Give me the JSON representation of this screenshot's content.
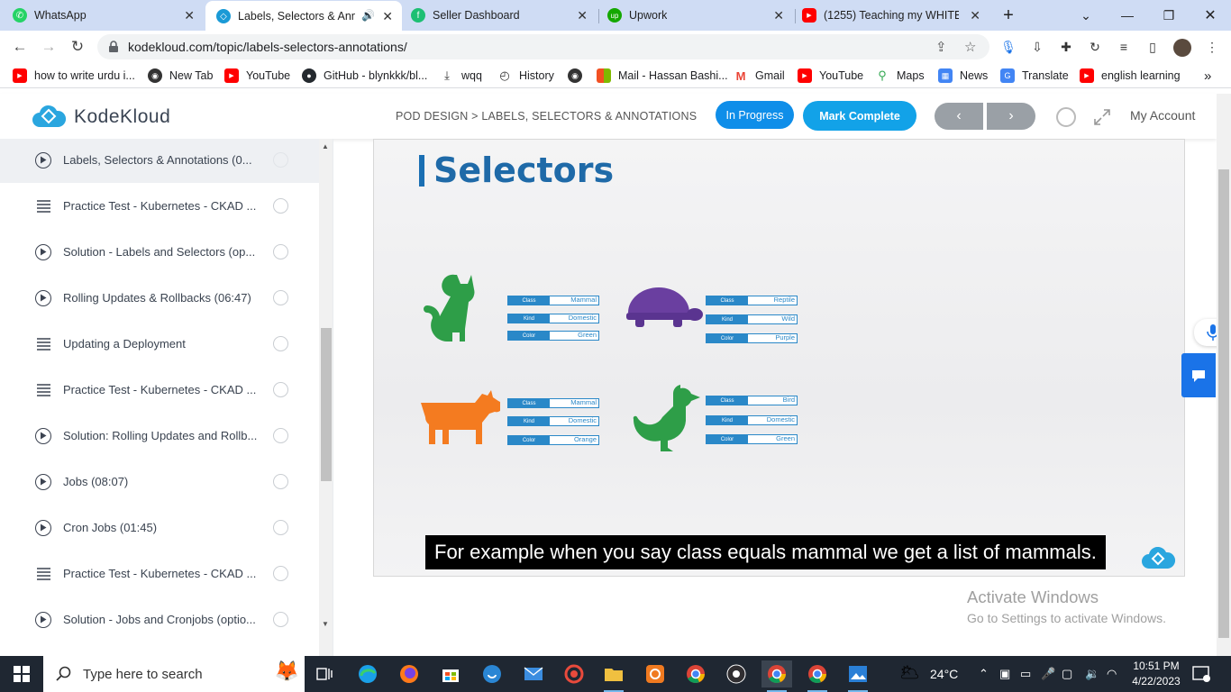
{
  "browser": {
    "tabs": [
      {
        "title": "WhatsApp",
        "icon": "whatsapp-icon",
        "color": "#25D366"
      },
      {
        "title": "Labels, Selectors & Anno",
        "icon": "kodekloud-icon",
        "color": "#1a9ad6"
      },
      {
        "title": "Seller Dashboard",
        "icon": "fiverr-icon",
        "color": "#1dbf73"
      },
      {
        "title": "Upwork",
        "icon": "upwork-icon",
        "color": "#14a800"
      },
      {
        "title": "(1255) Teaching my WHITE fr",
        "icon": "youtube-icon",
        "color": "#ff0000"
      }
    ],
    "url": "kodekloud.com/topic/labels-selectors-annotations/",
    "bookmarks": [
      {
        "label": "how to write urdu i...",
        "icon": "youtube-icon"
      },
      {
        "label": "New Tab",
        "icon": "globe-icon"
      },
      {
        "label": "YouTube",
        "icon": "youtube-icon"
      },
      {
        "label": "GitHub - blynkkk/bl...",
        "icon": "github-icon"
      },
      {
        "label": "wqq",
        "icon": "download-icon"
      },
      {
        "label": "History",
        "icon": "history-icon"
      },
      {
        "label": "",
        "icon": "globe-icon"
      },
      {
        "label": "Mail - Hassan Bashi...",
        "icon": "microsoft-icon"
      },
      {
        "label": "Gmail",
        "icon": "gmail-icon"
      },
      {
        "label": "YouTube",
        "icon": "youtube-icon"
      },
      {
        "label": "Maps",
        "icon": "maps-icon"
      },
      {
        "label": "News",
        "icon": "news-icon"
      },
      {
        "label": "Translate",
        "icon": "translate-icon"
      },
      {
        "label": "english learning",
        "icon": "youtube-icon"
      }
    ]
  },
  "site": {
    "logo_text": "KodeKloud",
    "breadcrumb": "POD DESIGN > LABELS, SELECTORS & ANNOTATIONS",
    "status_label": "In Progress",
    "complete_label": "Mark Complete",
    "account_label": "My Account",
    "accent": "#0f8ee9"
  },
  "lessons": [
    {
      "type": "video",
      "title": "Labels, Selectors & Annotations (0...",
      "selected": true
    },
    {
      "type": "test",
      "title": "Practice Test - Kubernetes - CKAD ..."
    },
    {
      "type": "video",
      "title": "Solution - Labels and Selectors (op..."
    },
    {
      "type": "video",
      "title": "Rolling Updates & Rollbacks (06:47)"
    },
    {
      "type": "test",
      "title": "Updating a Deployment"
    },
    {
      "type": "test",
      "title": "Practice Test - Kubernetes - CKAD ..."
    },
    {
      "type": "video",
      "title": "Solution: Rolling Updates and Rollb..."
    },
    {
      "type": "video",
      "title": "Jobs (08:07)"
    },
    {
      "type": "video",
      "title": "Cron Jobs (01:45)"
    },
    {
      "type": "test",
      "title": "Practice Test - Kubernetes - CKAD ..."
    },
    {
      "type": "video",
      "title": "Solution - Jobs and Cronjobs (optio..."
    }
  ],
  "video": {
    "slide_title": "Selectors",
    "subtitle": "For example when you say class equals mammal we get a list of mammals.",
    "cards": [
      {
        "animal": "cat",
        "color": "#2e9e48",
        "tags": [
          [
            "Class",
            "Mammal"
          ],
          [
            "Kind",
            "Domestic"
          ],
          [
            "Color",
            "Green"
          ]
        ]
      },
      {
        "animal": "turtle",
        "color": "#6a3fa0",
        "tags": [
          [
            "Class",
            "Reptile"
          ],
          [
            "Kind",
            "Wild"
          ],
          [
            "Color",
            "Purple"
          ]
        ]
      },
      {
        "animal": "cow",
        "color": "#f47b20",
        "tags": [
          [
            "Class",
            "Mammal"
          ],
          [
            "Kind",
            "Domestic"
          ],
          [
            "Color",
            "Orange"
          ]
        ]
      },
      {
        "animal": "duck",
        "color": "#2e9e48",
        "tags": [
          [
            "Class",
            "Bird"
          ],
          [
            "Kind",
            "Domestic"
          ],
          [
            "Color",
            "Green"
          ]
        ]
      }
    ]
  },
  "watermark": {
    "line1": "Activate Windows",
    "line2": "Go to Settings to activate Windows."
  },
  "taskbar": {
    "search_placeholder": "Type here to search",
    "temperature": "24°C",
    "time": "10:51 PM",
    "date": "4/22/2023"
  }
}
